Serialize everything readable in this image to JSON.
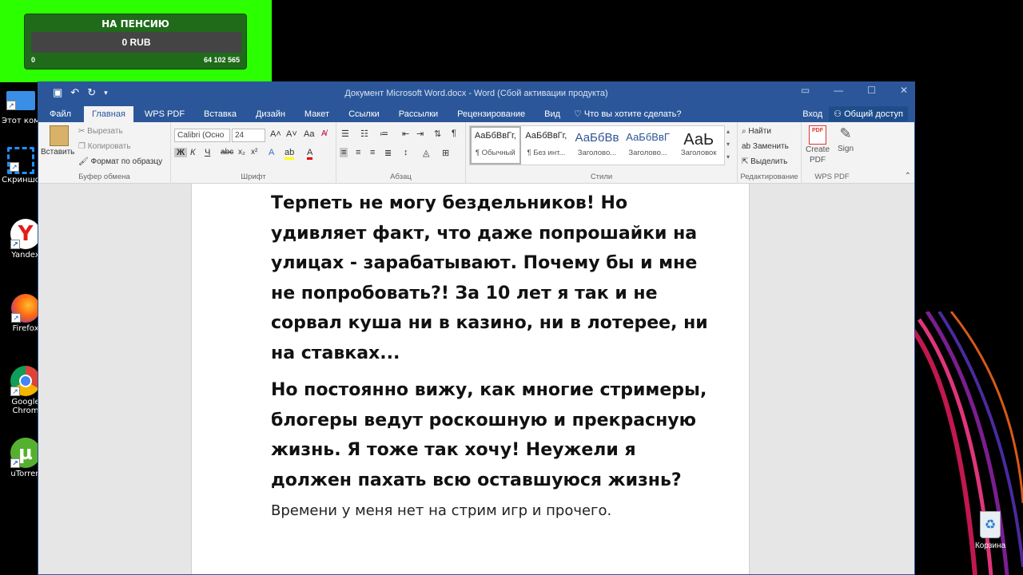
{
  "overlay": {
    "title": "НА ПЕНСИЮ",
    "value": "0 RUB",
    "min": "0",
    "max": "64 102 565",
    "progress_fraction": 0,
    "color": "#2bff00"
  },
  "desktop": {
    "icons": [
      {
        "label": "Этот компьют",
        "icon": "computer-icon"
      },
      {
        "label": "Скриншо",
        "icon": "screenshot-icon"
      },
      {
        "label": "Yandex",
        "icon": "yandex-icon"
      },
      {
        "label": "Firefox",
        "icon": "firefox-icon"
      },
      {
        "label": "Google Chrom",
        "icon": "chrome-icon"
      },
      {
        "label": "uTorren",
        "icon": "utorrent-icon"
      }
    ],
    "recycle_bin": "Корзина"
  },
  "word": {
    "window_title": "Документ Microsoft Word.docx  -  Word (Сбой активации продукта)",
    "tabs": [
      "Файл",
      "Главная",
      "WPS PDF",
      "Вставка",
      "Дизайн",
      "Макет",
      "Ссылки",
      "Рассылки",
      "Рецензирование",
      "Вид"
    ],
    "active_tab": "Главная",
    "tell_me": "Что вы хотите сделать?",
    "sign_in": "Вход",
    "share": "Общий доступ",
    "accent": "#2b579a",
    "clipboard": {
      "paste": "Вставить",
      "cut": "Вырезать",
      "copy": "Копировать",
      "format_painter": "Формат по образцу",
      "label": "Буфер обмена"
    },
    "font": {
      "name": "Calibri (Осно",
      "size": "24",
      "label": "Шрифт",
      "bold": "Ж",
      "italic": "К",
      "underline": "Ч"
    },
    "paragraph_label": "Абзац",
    "styles": {
      "label": "Стили",
      "items": [
        {
          "sample": "АаБбВвГг,",
          "name": "¶ Обычный"
        },
        {
          "sample": "АаБбВвГг,",
          "name": "¶ Без инт..."
        },
        {
          "sample": "АаБбВв",
          "name": "Заголово..."
        },
        {
          "sample": "АаБбВвГ",
          "name": "Заголово..."
        },
        {
          "sample": "АаЬ",
          "name": "Заголовок"
        }
      ]
    },
    "editing": {
      "find": "Найти",
      "replace": "Заменить",
      "select": "Выделить",
      "label": "Редактирование"
    },
    "wps": {
      "create_pdf": "Create PDF",
      "sign": "Sign",
      "label": "WPS PDF"
    },
    "document": {
      "paragraphs": [
        "Терпеть не могу бездельников! Но удивляет факт, что даже попрошайки на улицах - зарабатывают. Почему бы и мне не попробовать?! За 10 лет я так и не сорвал куша ни в казино, ни в лотерее, ни на ставках...",
        "Но постоянно вижу, как многие стримеры, блогеры ведут роскошную и прекрасную жизнь. Я тоже так хочу! Неужели я должен пахать всю оставшуюся жизнь?",
        "Времени у меня нет на стрим игр и прочего."
      ]
    }
  }
}
